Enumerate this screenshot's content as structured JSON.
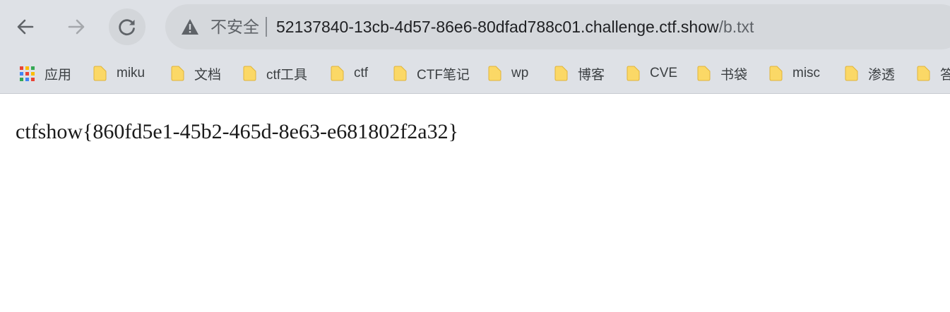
{
  "toolbar": {
    "back_icon": "arrow-left-icon",
    "forward_icon": "arrow-right-icon",
    "reload_icon": "reload-icon"
  },
  "omnibox": {
    "security_icon": "warning-triangle-icon",
    "security_text": "不安全",
    "host": "52137840-13cb-4d57-86e6-80dfad788c01.challenge.ctf.show",
    "path": "/b.txt"
  },
  "bookmarks": [
    {
      "label": "应用",
      "icon": "apps-grid-icon"
    },
    {
      "label": "miku",
      "icon": "folder-icon"
    },
    {
      "label": "文档",
      "icon": "folder-icon"
    },
    {
      "label": "ctf工具",
      "icon": "folder-icon"
    },
    {
      "label": "ctf",
      "icon": "folder-icon"
    },
    {
      "label": "CTF笔记",
      "icon": "folder-icon"
    },
    {
      "label": "wp",
      "icon": "folder-icon"
    },
    {
      "label": "博客",
      "icon": "folder-icon"
    },
    {
      "label": "CVE",
      "icon": "folder-icon"
    },
    {
      "label": "书袋",
      "icon": "folder-icon"
    },
    {
      "label": "misc",
      "icon": "folder-icon"
    },
    {
      "label": "渗透",
      "icon": "folder-icon"
    },
    {
      "label": "答",
      "icon": "folder-icon"
    }
  ],
  "page": {
    "text": "ctfshow{860fd5e1-45b2-465d-8e63-e681802f2a32}"
  },
  "colors": {
    "chrome_bg": "#dee1e6",
    "omnibox_bg": "#d5d8dc",
    "folder_yellow": "#fbd866",
    "text_primary": "#202124",
    "text_secondary": "#5f6368"
  }
}
